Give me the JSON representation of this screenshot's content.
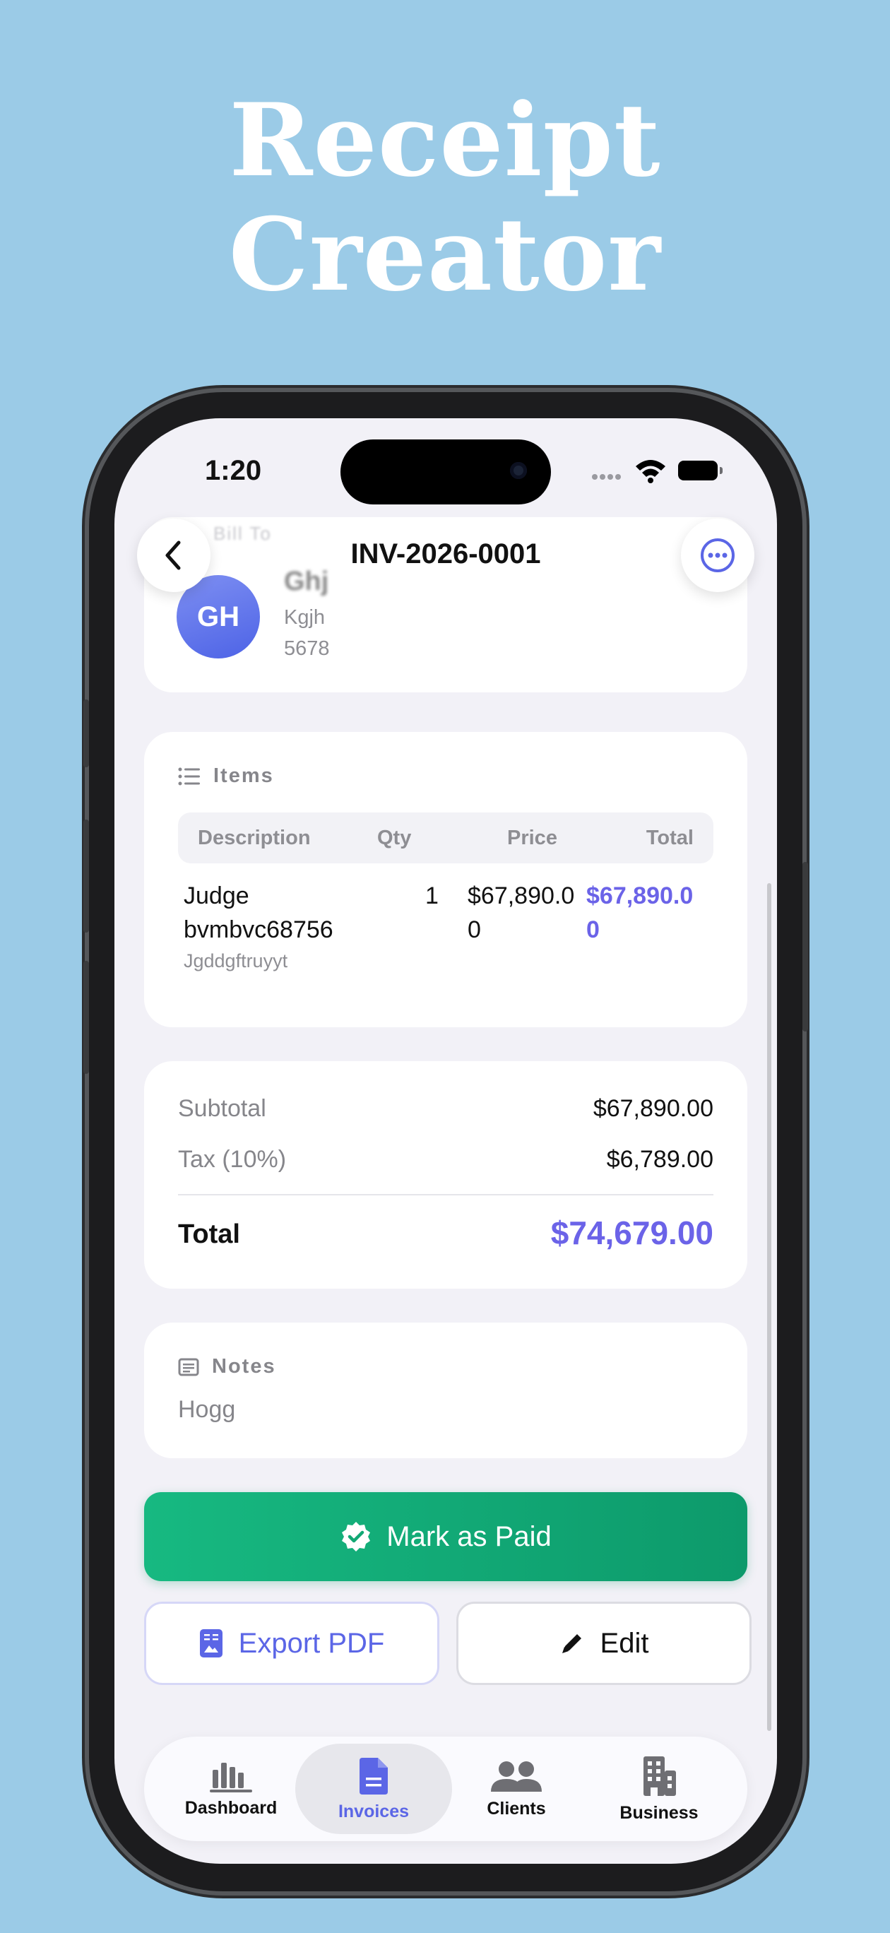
{
  "promo": {
    "headline_line1": "Receipt",
    "headline_line2": "Creator"
  },
  "status_bar": {
    "time": "1:20"
  },
  "nav": {
    "title": "INV-2026-0001",
    "back_icon": "chevron-left-icon",
    "more_icon": "ellipsis-circle-icon"
  },
  "client": {
    "section_label": "Bill To",
    "initials": "GH",
    "name": "Ghj",
    "line1": "Kgjh",
    "line2": "5678"
  },
  "items": {
    "section_label": "Items",
    "columns": {
      "description": "Description",
      "qty": "Qty",
      "price": "Price",
      "total": "Total"
    },
    "rows": [
      {
        "name_line1": "Judge",
        "name_line2": "bvmbvc68756",
        "subtitle": "Jgddgftruyyt",
        "qty": "1",
        "price_line1": "$67,890.0",
        "price_line2": "0",
        "total_line1": "$67,890.0",
        "total_line2": "0"
      }
    ]
  },
  "summary": {
    "subtotal_label": "Subtotal",
    "subtotal_value": "$67,890.00",
    "tax_label": "Tax (10%)",
    "tax_value": "$6,789.00",
    "total_label": "Total",
    "total_value": "$74,679.00"
  },
  "notes": {
    "section_label": "Notes",
    "text": "Hogg"
  },
  "actions": {
    "mark_paid": "Mark as Paid",
    "export_pdf": "Export PDF",
    "edit": "Edit"
  },
  "tabs": [
    {
      "label": "Dashboard",
      "icon": "chart-bar-icon"
    },
    {
      "label": "Invoices",
      "icon": "document-icon",
      "active": true
    },
    {
      "label": "Clients",
      "icon": "people-icon"
    },
    {
      "label": "Business",
      "icon": "building-icon"
    }
  ],
  "colors": {
    "background": "#9bcbe7",
    "accent": "#5b66e6",
    "success": "#12a874",
    "total_accent": "#6b63e8"
  }
}
